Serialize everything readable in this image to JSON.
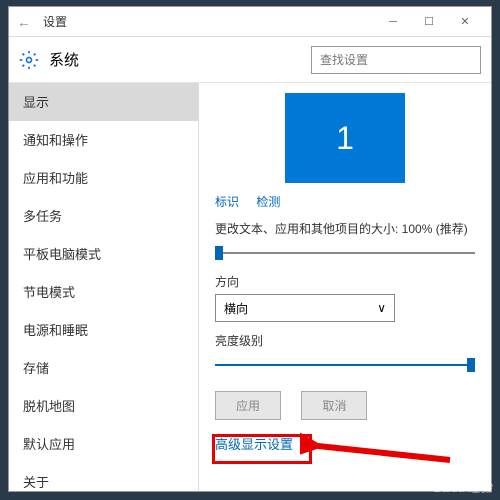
{
  "window": {
    "title": "设置"
  },
  "header": {
    "app_title": "系统",
    "search_placeholder": "查找设置"
  },
  "sidebar": {
    "items": [
      {
        "label": "显示",
        "selected": true
      },
      {
        "label": "通知和操作"
      },
      {
        "label": "应用和功能"
      },
      {
        "label": "多任务"
      },
      {
        "label": "平板电脑模式"
      },
      {
        "label": "节电模式"
      },
      {
        "label": "电源和睡眠"
      },
      {
        "label": "存储"
      },
      {
        "label": "脱机地图"
      },
      {
        "label": "默认应用"
      },
      {
        "label": "关于"
      }
    ]
  },
  "main": {
    "monitor_number": "1",
    "identify": "标识",
    "detect": "检测",
    "scale_label": "更改文本、应用和其他项目的大小: 100% (推荐)",
    "scale_percent": 0,
    "orientation_label": "方向",
    "orientation_value": "横向",
    "brightness_label": "亮度级别",
    "brightness_percent": 100,
    "apply": "应用",
    "cancel": "取消",
    "advanced_link": "高级显示设置"
  },
  "watermark": "Baidu 经验"
}
